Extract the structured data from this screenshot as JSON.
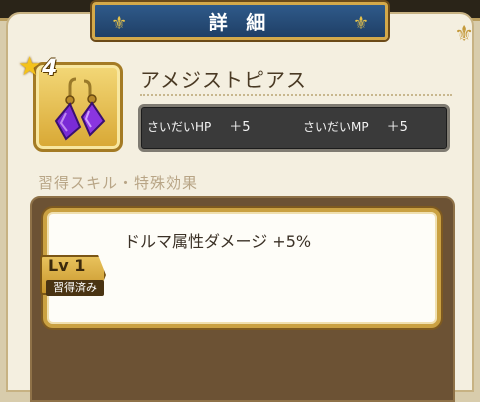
{
  "header": {
    "title": "詳 細"
  },
  "item": {
    "rarity": "4",
    "name": "アメジストピアス",
    "stats": [
      {
        "label": "さいだいHP",
        "value": "＋5"
      },
      {
        "label": "さいだいMP",
        "value": "＋5"
      }
    ]
  },
  "skills": {
    "section_label": "習得スキル・特殊効果",
    "entries": [
      {
        "level": "Lv 1",
        "status": "習得済み",
        "text": "ドルマ属性ダメージ +5%"
      }
    ]
  },
  "colors": {
    "banner": "#2f5a8a",
    "gold_border": "#d4a94a",
    "panel_bg": "#f4efe0",
    "skills_bg": "#6c5234",
    "stats_bg": "#3a3a3a"
  },
  "icons": [
    "star-icon",
    "amethyst-earrings-icon",
    "fleur-de-lis-icon"
  ]
}
